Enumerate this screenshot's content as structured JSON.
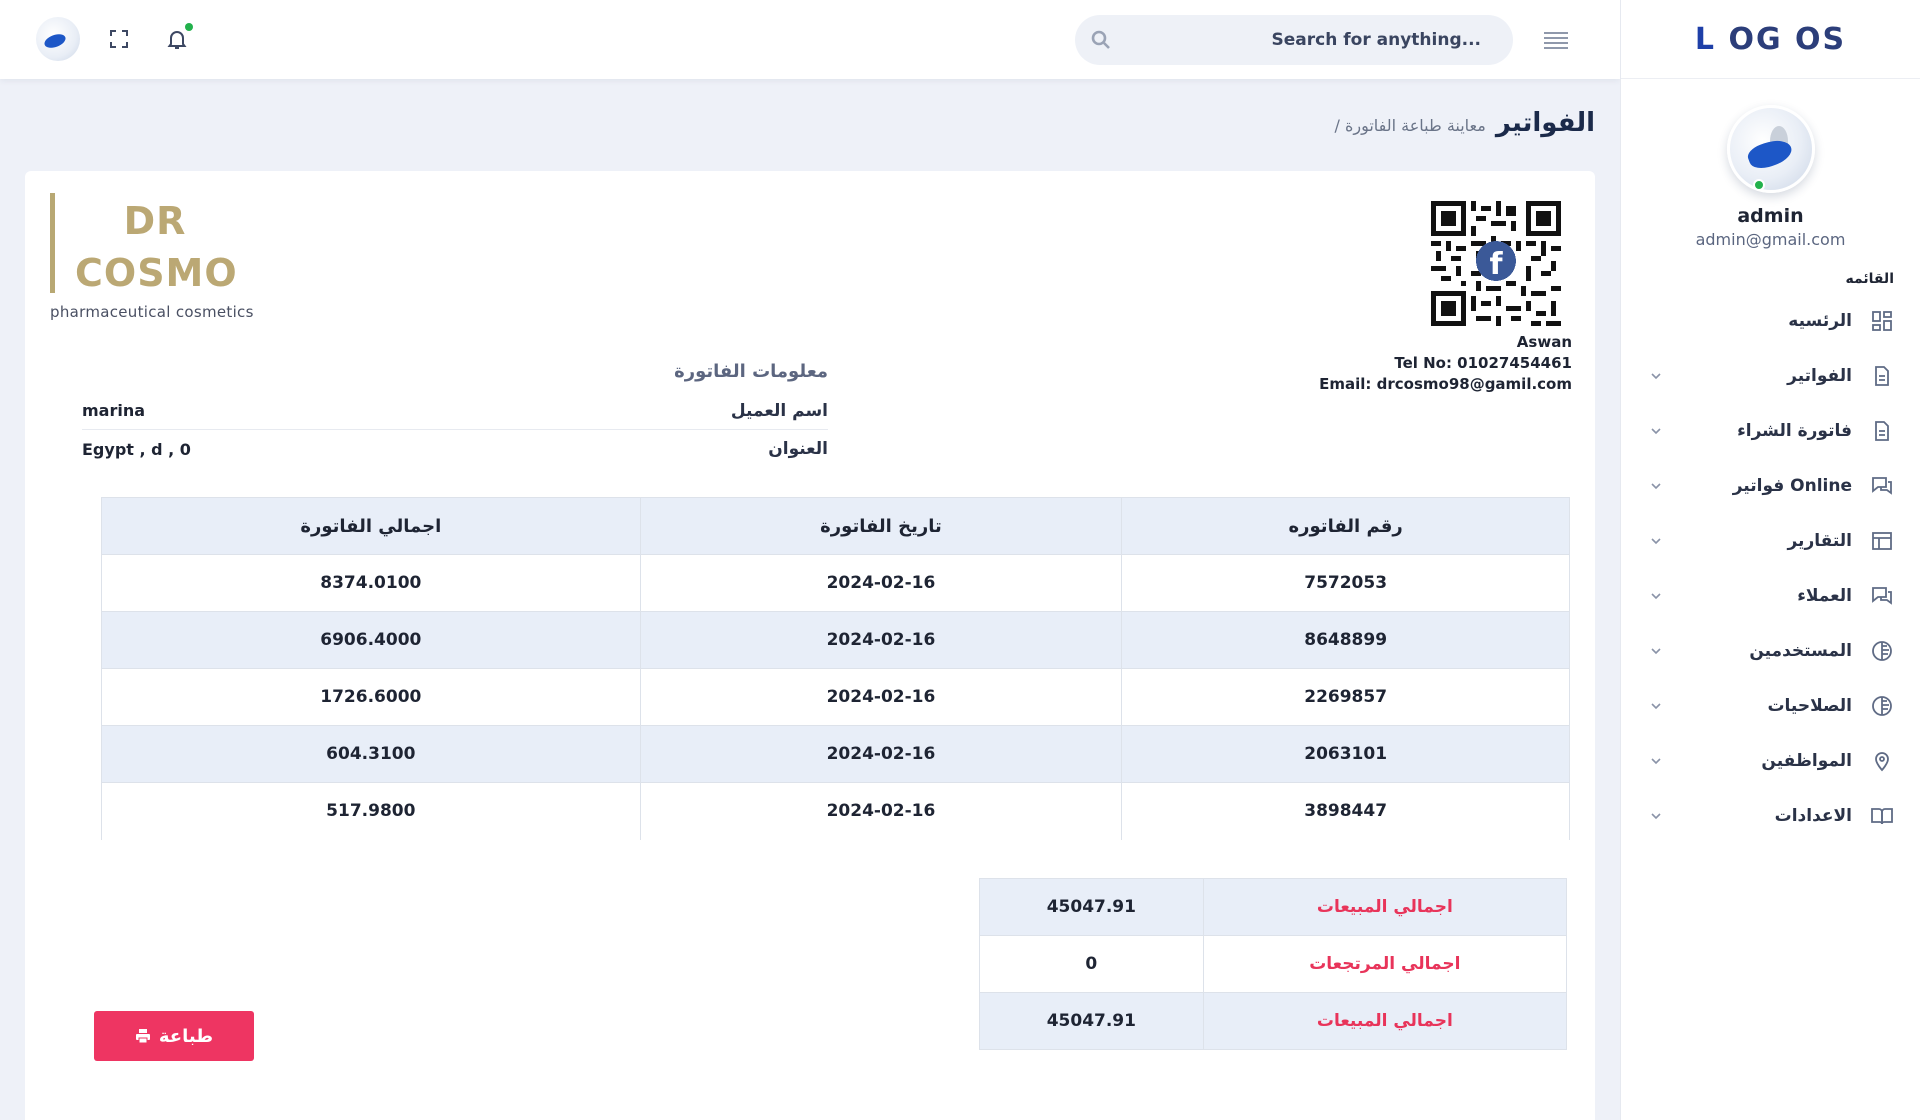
{
  "app": {
    "logo_l": "L",
    "logo_rest": "OG OS"
  },
  "user": {
    "name": "admin",
    "email": "admin@gmail.com"
  },
  "sidebar": {
    "menu_title": "القائمه",
    "items": [
      {
        "label": "الرئسيه",
        "icon": "dashboard-icon",
        "has_children": false
      },
      {
        "label": "الفواتير",
        "icon": "document-icon",
        "has_children": true
      },
      {
        "label": "فاتورة الشراء",
        "icon": "document-icon",
        "has_children": true
      },
      {
        "label": "فواتير Online",
        "icon": "chat-icon",
        "has_children": true
      },
      {
        "label": "التقارير",
        "icon": "table-icon",
        "has_children": true
      },
      {
        "label": "العملاء",
        "icon": "chat-icon",
        "has_children": true
      },
      {
        "label": "المستخدمين",
        "icon": "half-circle-icon",
        "has_children": true
      },
      {
        "label": "الصلاحيات",
        "icon": "half-circle-icon",
        "has_children": true
      },
      {
        "label": "المواظفين",
        "icon": "location-pin-icon",
        "has_children": true
      },
      {
        "label": "الاعدادات",
        "icon": "book-icon",
        "has_children": true
      }
    ]
  },
  "header": {
    "search_placeholder": "Search for anything..."
  },
  "breadcrumb": {
    "title": "الفواتير",
    "sub": "/ معاينة طباعة الفاتورة"
  },
  "brand": {
    "line1": "DR",
    "line2": "COSMO",
    "tagline": "pharmaceutical cosmetics"
  },
  "contact": {
    "city": "Aswan",
    "tel": "Tel No: 01027454461",
    "email": "Email: drcosmo98@gamil.com"
  },
  "invoice_info": {
    "title": "معلومات الفاتورة",
    "client_label": "اسم العميل",
    "client_value": "marina",
    "address_label": "العنوان",
    "address_value": "Egypt , d , 0"
  },
  "invoice_table": {
    "headers": {
      "number": "رقم الفاتوره",
      "date": "تاريخ الفاتورة",
      "total": "اجمالي الفاتورة"
    },
    "rows": [
      {
        "number": "7572053",
        "date": "2024-02-16",
        "total": "8374.0100"
      },
      {
        "number": "8648899",
        "date": "2024-02-16",
        "total": "6906.4000"
      },
      {
        "number": "2269857",
        "date": "2024-02-16",
        "total": "1726.6000"
      },
      {
        "number": "2063101",
        "date": "2024-02-16",
        "total": "604.3100"
      },
      {
        "number": "3898447",
        "date": "2024-02-16",
        "total": "517.9800"
      }
    ]
  },
  "totals": [
    {
      "label": "اجمالي المبيعات",
      "value": "45047.91"
    },
    {
      "label": "اجمالي المرتجعات",
      "value": "0"
    },
    {
      "label": "اجمالي المبيعات",
      "value": "45047.91"
    }
  ],
  "actions": {
    "print_label": "طباعة"
  },
  "colors": {
    "accent": "#ee3562",
    "brand_gold": "#bba874",
    "online": "#22b14c"
  }
}
